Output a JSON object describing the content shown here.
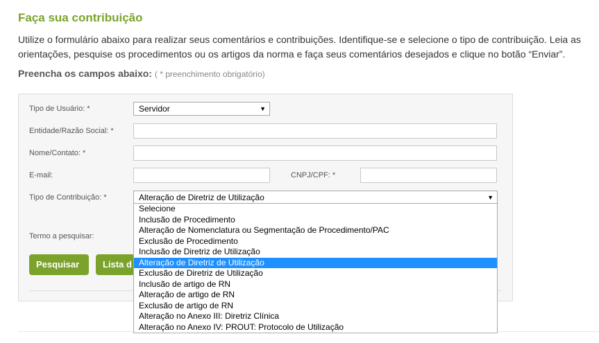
{
  "page": {
    "title": "Faça sua contribuição",
    "intro": "Utilize o formulário abaixo para realizar seus comentários e contribuições. Identifique-se e selecione o tipo de contribuição. Leia as orientações, pesquise os procedimentos ou os artigos da norma e faça seus comentários desejados e clique no botão “Enviar”.",
    "fill_label": "Preencha os campos abaixo:",
    "fill_hint": "( * preenchimento obrigatório)"
  },
  "form": {
    "tipo_usuario": {
      "label": "Tipo de Usuário: *",
      "value": "Servidor"
    },
    "entidade": {
      "label": "Entidade/Razão Social: *",
      "value": ""
    },
    "nome": {
      "label": "Nome/Contato: *",
      "value": ""
    },
    "email": {
      "label": "E-mail:",
      "value": ""
    },
    "cnpj": {
      "label": "CNPJ/CPF: *",
      "value": ""
    },
    "tipo_contribuicao": {
      "label": "Tipo de Contribuição: *",
      "value": "Alteração de Diretriz de Utilização",
      "options": [
        "Selecione",
        "Inclusão de Procedimento",
        "Alteração de Nomenclatura ou Segmentação de Procedimento/PAC",
        "Exclusão de Procedimento",
        "Inclusão de Diretriz de Utilização",
        "Alteração de Diretriz de Utilização",
        "Exclusão de Diretriz de Utilização",
        "Inclusão de artigo de RN",
        "Alteração de artigo de RN",
        "Exclusão de artigo de RN",
        "Alteração no Anexo III: Diretriz Clínica",
        "Alteração no Anexo IV: PROUT: Protocolo de Utilização"
      ],
      "selected_index": 5
    },
    "termo": {
      "label": "Termo a pesquisar:"
    },
    "buttons": {
      "pesquisar": "Pesquisar",
      "lista": "Lista d"
    }
  },
  "colors": {
    "accent": "#7ba32b",
    "highlight": "#1e90ff"
  }
}
